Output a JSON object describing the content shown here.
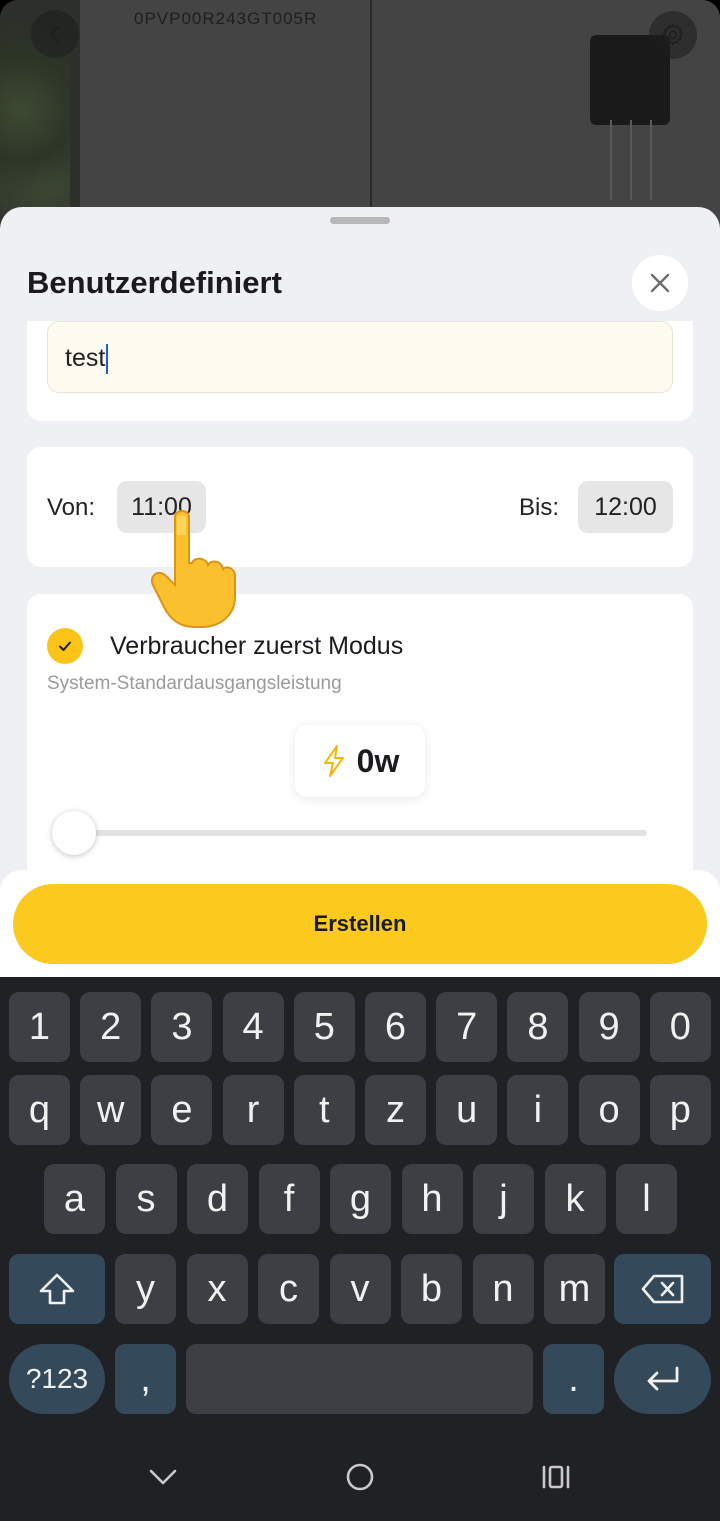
{
  "device": {
    "serial": "0PVP00R243GT005R"
  },
  "sheet": {
    "title": "Benutzerdefiniert",
    "name_value": "test"
  },
  "time": {
    "from_label": "Von:",
    "from_value": "11:00",
    "to_label": "Bis:",
    "to_value": "12:00"
  },
  "mode": {
    "title": "Verbraucher zuerst Modus",
    "subtitle": "System-Standardausgangsleistung",
    "power_value": "0w",
    "power_level": 0
  },
  "footer": {
    "create_label": "Erstellen"
  },
  "keyboard": {
    "row_numbers": [
      "1",
      "2",
      "3",
      "4",
      "5",
      "6",
      "7",
      "8",
      "9",
      "0"
    ],
    "row_top": [
      "q",
      "w",
      "e",
      "r",
      "t",
      "z",
      "u",
      "i",
      "o",
      "p"
    ],
    "row_middle": [
      "a",
      "s",
      "d",
      "f",
      "g",
      "h",
      "j",
      "k",
      "l"
    ],
    "row_bottom": [
      "y",
      "x",
      "c",
      "v",
      "b",
      "n",
      "m"
    ],
    "symbols_label": "?123",
    "comma_label": ",",
    "period_label": "."
  },
  "colors": {
    "accent": "#fcc91f",
    "keyboard_bg": "#1f2124",
    "key_bg": "#3c3f43",
    "special_key_bg": "#34495a"
  },
  "icons": [
    "back-icon",
    "gear-icon",
    "close-icon",
    "check-icon",
    "lightning-icon",
    "shift-icon",
    "backspace-icon",
    "enter-icon",
    "nav-back-icon",
    "nav-home-icon",
    "nav-recents-icon",
    "pointing-hand-icon"
  ]
}
